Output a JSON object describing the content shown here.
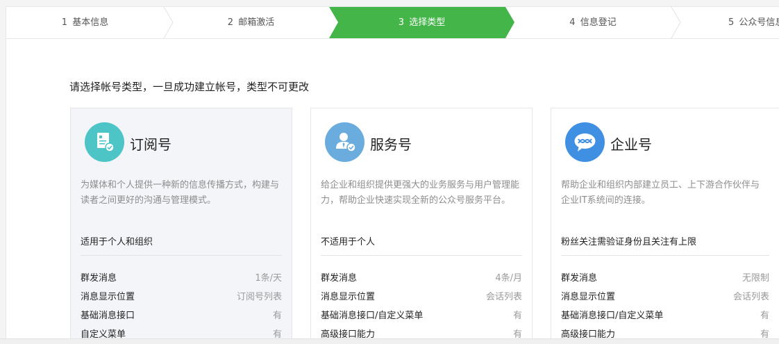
{
  "steps": [
    {
      "num": "1",
      "label": "基本信息",
      "active": false
    },
    {
      "num": "2",
      "label": "邮箱激活",
      "active": false
    },
    {
      "num": "3",
      "label": "选择类型",
      "active": true
    },
    {
      "num": "4",
      "label": "信息登记",
      "active": false
    },
    {
      "num": "5",
      "label": "公众号信息",
      "active": false
    }
  ],
  "heading": "请选择帐号类型，一旦成功建立帐号，类型不可更改",
  "colors": {
    "accent": "#44b549",
    "subscription_icon": "#4dc4c6",
    "service_icon": "#6aacdd",
    "enterprise_icon": "#3f8fe2"
  },
  "cards": [
    {
      "icon": "document-check-icon",
      "title": "订阅号",
      "desc": "为媒体和个人提供一种新的信息传播方式，构建与读者之间更好的沟通与管理模式。",
      "scope": "适用于个人和组织",
      "features": [
        {
          "name": "群发消息",
          "value": "1条/天"
        },
        {
          "name": "消息显示位置",
          "value": "订阅号列表"
        },
        {
          "name": "基础消息接口",
          "value": "有"
        },
        {
          "name": "自定义菜单",
          "value": "有"
        }
      ]
    },
    {
      "icon": "person-check-icon",
      "title": "服务号",
      "desc": "给企业和组织提供更强大的业务服务与用户管理能力，帮助企业快速实现全新的公众号服务平台。",
      "scope": "不适用于个人",
      "features": [
        {
          "name": "群发消息",
          "value": "4条/月"
        },
        {
          "name": "消息显示位置",
          "value": "会话列表"
        },
        {
          "name": "基础消息接口/自定义菜单",
          "value": "有"
        },
        {
          "name": "高级接口能力",
          "value": "有"
        }
      ]
    },
    {
      "icon": "chat-bubble-icon",
      "title": "企业号",
      "desc": "帮助企业和组织内部建立员工、上下游合作伙伴与企业IT系统间的连接。",
      "scope": "粉丝关注需验证身份且关注有上限",
      "features": [
        {
          "name": "群发消息",
          "value": "无限制"
        },
        {
          "name": "消息显示位置",
          "value": "会话列表"
        },
        {
          "name": "基础消息接口/自定义菜单",
          "value": "有"
        },
        {
          "name": "高级接口能力",
          "value": "有"
        }
      ]
    }
  ]
}
